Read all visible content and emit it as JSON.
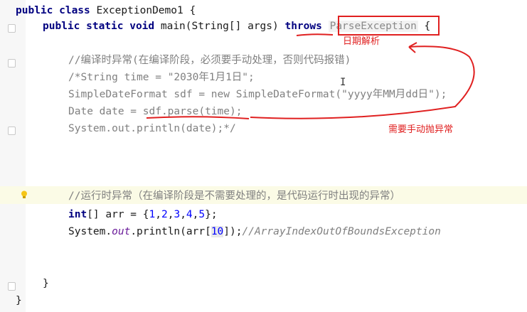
{
  "editor": {
    "line1": {
      "kw": "public class",
      "rest": " ExceptionDemo1 {"
    },
    "line2": {
      "kw": "public static void",
      "rest": " main(String[] args) ",
      "throws": "throws",
      "exception": "ParseException",
      "brace": " {"
    },
    "line3": {
      "comment": "//编译时异常(在编译阶段，必须要手动处理，否则代码报错)"
    },
    "line4": {
      "pre": "/*String time = ",
      "str": "\"2030年1月1日\"",
      "post": ";"
    },
    "line5": {
      "pre": "SimpleDateFormat sdf = new SimpleDateFormat(",
      "str": "\"yyyy年MM月dd日\"",
      "post": ");"
    },
    "line6": {
      "pre": "Date date = ",
      "call": "sdf.parse(time);"
    },
    "line7": {
      "text": "System.out.println(date);*/"
    },
    "line8": {
      "comment": "//运行时异常（在编译阶段是不需要处理的，是代码运行时出现的异常）"
    },
    "line9": {
      "kw": "int",
      "pre": "[] arr = {",
      "n1": "1",
      "c1": ",",
      "n2": "2",
      "c2": ",",
      "n3": "3",
      "c3": ",",
      "n4": "4",
      "c4": ",",
      "n5": "5",
      "post": "};"
    },
    "line10": {
      "pre": "System.",
      "field": "out",
      "mid": ".println(arr[",
      "idx": "10",
      "post": "]);",
      "comment": "//ArrayIndexOutOfBoundsException"
    },
    "close_inner": "}",
    "close_outer": "}"
  },
  "annotations": {
    "date_parse": "日期解析",
    "need_throw": "需要手动抛异常"
  },
  "colors": {
    "annotation_red": "#e02020",
    "keyword": "#000080",
    "comment": "#808080",
    "number": "#0000ff"
  }
}
